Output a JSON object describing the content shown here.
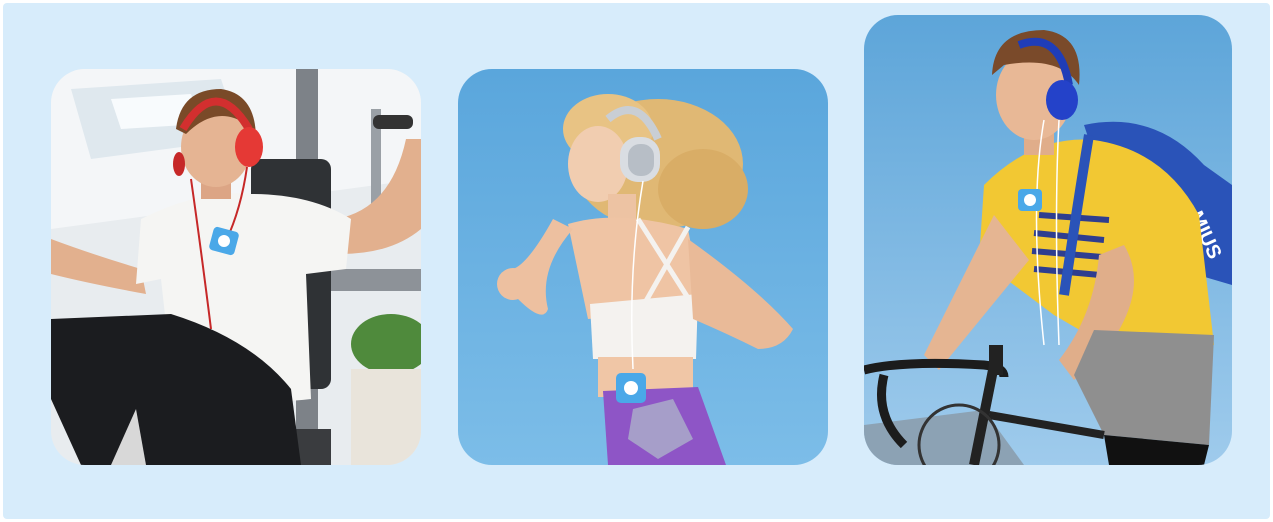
{
  "gallery": {
    "items": [
      {
        "scene": "gym",
        "headphone_color": "#e53935",
        "player_color": "#4aa8e8"
      },
      {
        "scene": "running",
        "headphone_color": "#d9dde2",
        "player_color": "#4aa8e8"
      },
      {
        "scene": "cycling",
        "headphone_color": "#2442c9",
        "player_color": "#4aa8e8"
      }
    ],
    "backpack_text": "MIUS"
  },
  "colors": {
    "panel": "#d7ecfb",
    "sky": "#6fb4e3",
    "gym_bg": "#e6eaed"
  }
}
